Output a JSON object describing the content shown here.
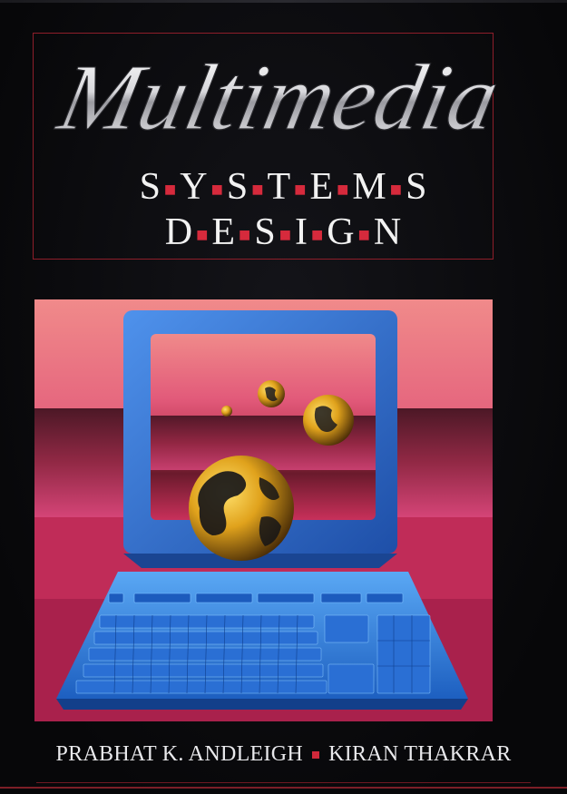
{
  "cover": {
    "title": "Multimedia",
    "subtitle_line1": [
      "S",
      "Y",
      "S",
      "T",
      "E",
      "M",
      "S"
    ],
    "subtitle_line2": [
      "D",
      "E",
      "S",
      "I",
      "G",
      "N"
    ],
    "authors": {
      "first": "PRABHAT K. ANDLEIGH",
      "second": "KIRAN THAKRAR"
    }
  },
  "colors": {
    "background": "#0b0b0d",
    "frame": "#8e1e2a",
    "accent_red": "#d62a3c",
    "sky_pink": "#e25a7a",
    "monitor_blue": "#2d6fd0",
    "keyboard_blue": "#3a8ee6",
    "globe_gold": "#e0a21c"
  },
  "icons": {
    "illustration": "computer-with-globes"
  }
}
